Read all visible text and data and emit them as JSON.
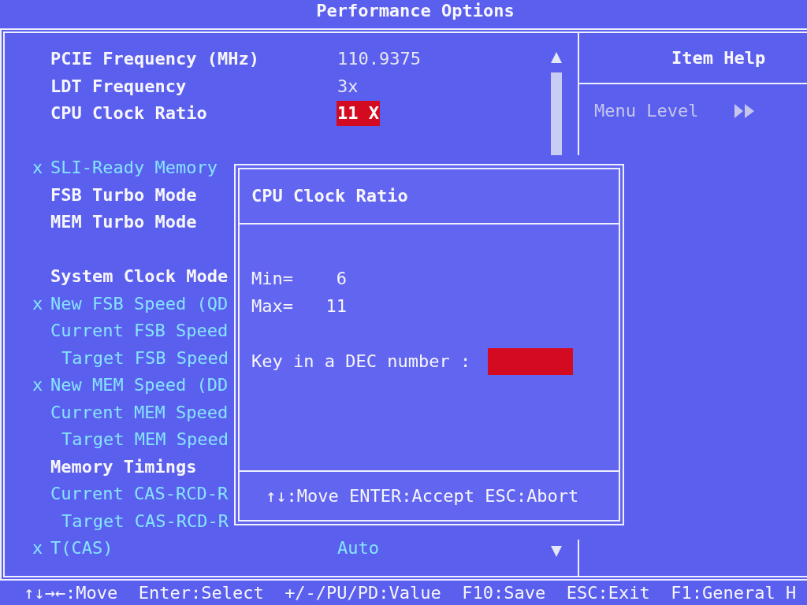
{
  "title": "Performance Options",
  "settings": {
    "groups": [
      {
        "rows": [
          {
            "kind": "item",
            "label": "PCIE Frequency (MHz)",
            "value": "110.9375",
            "disabled": false,
            "selected": false
          },
          {
            "kind": "item",
            "label": "LDT Frequency",
            "value": "3x",
            "disabled": false,
            "selected": false
          },
          {
            "kind": "item",
            "label": "CPU Clock Ratio",
            "value": "11 X",
            "disabled": false,
            "selected": true
          }
        ]
      },
      {
        "rows": [
          {
            "kind": "item",
            "marker": "x",
            "label": "SLI-Ready Memory",
            "disabled": true,
            "selected": false
          },
          {
            "kind": "item",
            "label": "FSB Turbo Mode",
            "disabled": false,
            "selected": false
          },
          {
            "kind": "item",
            "label": "MEM Turbo Mode",
            "disabled": false,
            "selected": false
          }
        ]
      },
      {
        "rows": [
          {
            "kind": "item",
            "label": "System Clock Mode",
            "disabled": false,
            "selected": false
          },
          {
            "kind": "item",
            "marker": "x",
            "label": "New FSB Speed (QD",
            "disabled": true,
            "selected": false
          },
          {
            "kind": "item",
            "label": "Current FSB Speed",
            "disabled": true,
            "selected": false
          },
          {
            "kind": "sub",
            "label": "Target FSB Speed",
            "disabled": true,
            "selected": false
          },
          {
            "kind": "item",
            "marker": "x",
            "label": "New MEM Speed (DD",
            "disabled": true,
            "selected": false
          },
          {
            "kind": "item",
            "label": "Current MEM Speed",
            "disabled": true,
            "selected": false
          },
          {
            "kind": "sub",
            "label": "Target MEM Speed",
            "disabled": true,
            "selected": false
          },
          {
            "kind": "item",
            "label": "Memory Timings",
            "disabled": false,
            "selected": false
          },
          {
            "kind": "item",
            "label": "Current CAS-RCD-R",
            "disabled": true,
            "selected": false
          },
          {
            "kind": "sub",
            "label": "Target CAS-RCD-R",
            "disabled": true,
            "selected": false
          },
          {
            "kind": "item",
            "marker": "x",
            "label": "T(CAS)",
            "value": "Auto",
            "disabled": true,
            "selected": false
          }
        ]
      }
    ]
  },
  "help_panel": {
    "title": "Item Help",
    "menu_level": "Menu Level"
  },
  "dialog": {
    "title": "CPU Clock Ratio",
    "limits": [
      {
        "label": "Min=",
        "value": "6"
      },
      {
        "label": "Max=",
        "value": "11"
      }
    ],
    "prompt": "Key in a DEC number :",
    "hint": "↑↓:Move ENTER:Accept ESC:Abort"
  },
  "status_bar": "↑↓→←:Move  Enter:Select  +/-/PU/PD:Value  F10:Save  ESC:Exit  F1:General H"
}
